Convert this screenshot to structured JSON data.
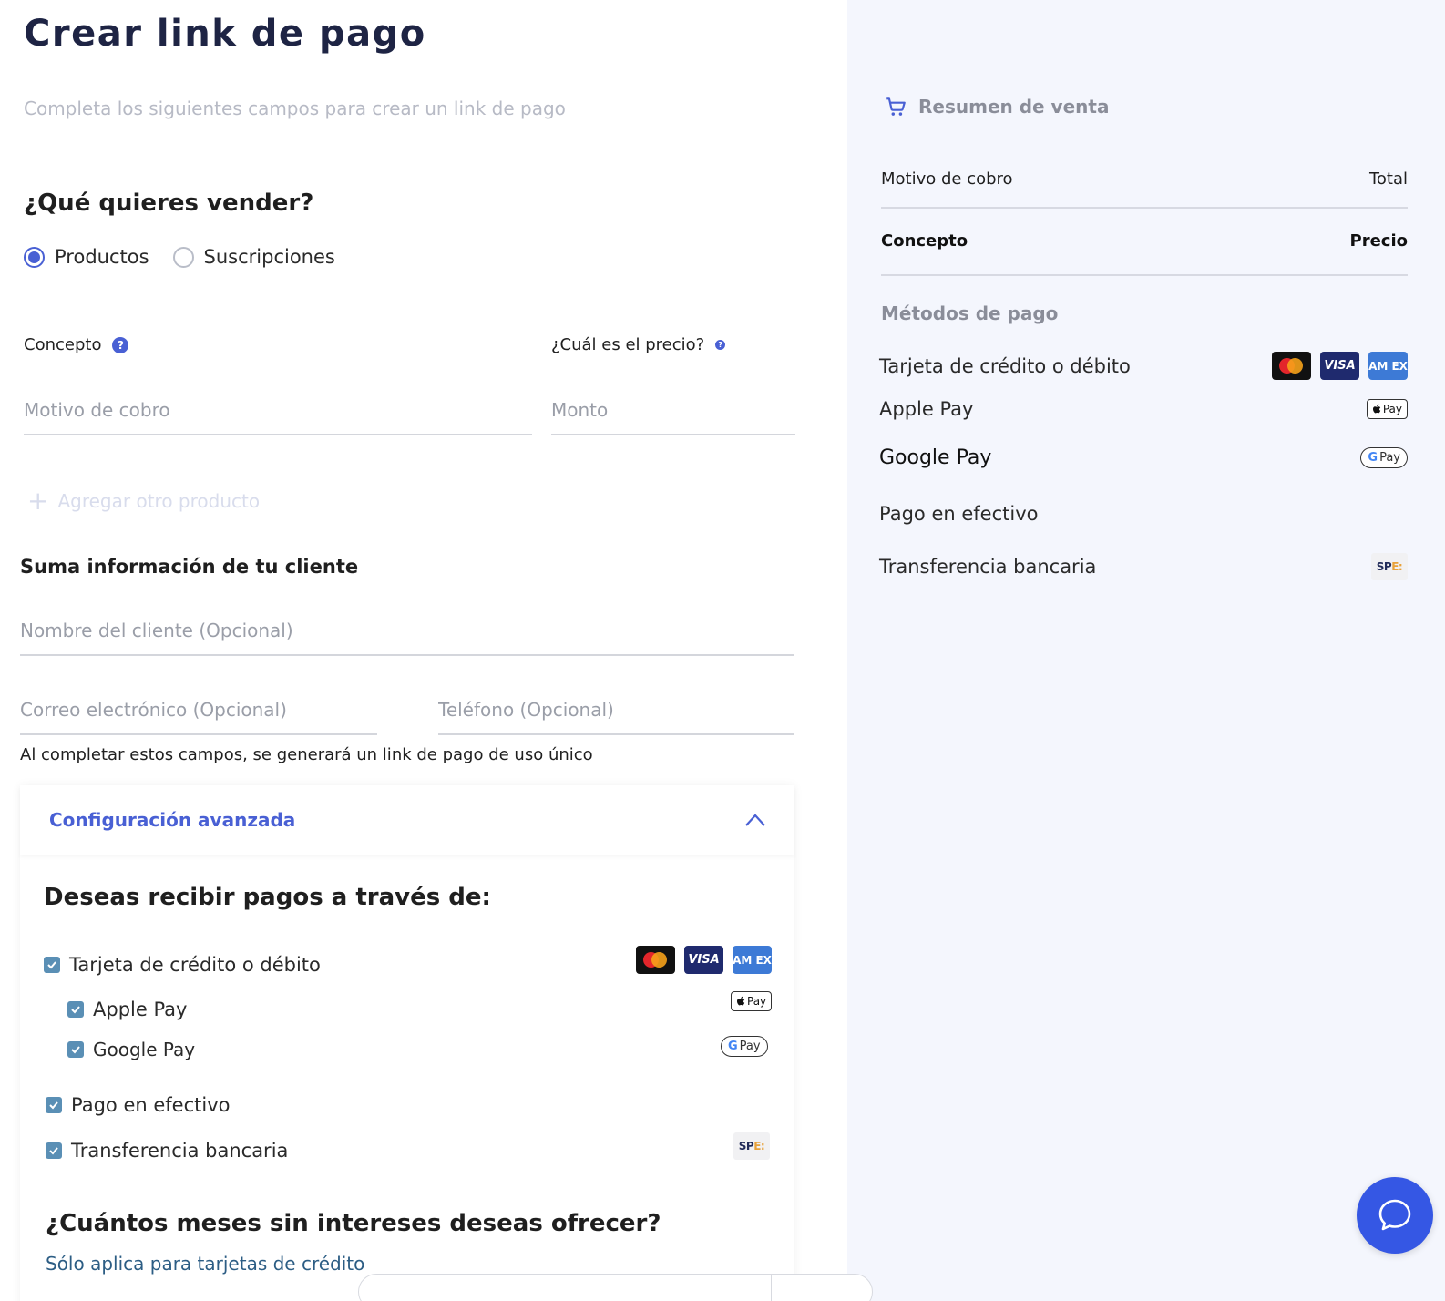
{
  "page": {
    "title": "Crear link de pago",
    "subtitle": "Completa los siguientes campos para crear un link de pago"
  },
  "sell": {
    "heading": "¿Qué quieres vender?",
    "options": [
      {
        "label": "Productos",
        "selected": true
      },
      {
        "label": "Suscripciones",
        "selected": false
      }
    ]
  },
  "product": {
    "concept_label": "Concepto",
    "concept_placeholder": "Motivo de cobro",
    "price_label": "¿Cuál es el precio?",
    "price_placeholder": "Monto",
    "add_label": "Agregar otro producto",
    "help_glyph": "?"
  },
  "client": {
    "heading": "Suma información de tu cliente",
    "name_placeholder": "Nombre del cliente (Opcional)",
    "email_placeholder": "Correo electrónico (Opcional)",
    "phone_placeholder": "Teléfono (Opcional)",
    "note": "Al completar estos campos, se generará un link de pago de uso único"
  },
  "advanced": {
    "title": "Configuración avanzada",
    "payments_heading": "Deseas recibir pagos a través de:",
    "methods": [
      {
        "label": "Tarjeta de crédito o débito",
        "checked": true
      },
      {
        "label": "Apple Pay",
        "checked": true
      },
      {
        "label": "Google Pay",
        "checked": true
      },
      {
        "label": "Pago en efectivo",
        "checked": true
      },
      {
        "label": "Transferencia bancaria",
        "checked": true
      }
    ],
    "msi_heading": "¿Cuántos meses sin intereses deseas ofrecer?",
    "msi_note": "Sólo aplica para tarjetas de crédito"
  },
  "logos": {
    "visa": "VISA",
    "amex": "AM EX",
    "apple_pay": "Pay",
    "google_pay_g": "G",
    "google_pay": "Pay",
    "spei_a": "SP",
    "spei_b": "E:"
  },
  "summary": {
    "title": "Resumen de venta",
    "col_left": "Motivo de cobro",
    "col_right": "Total",
    "row_left": "Concepto",
    "row_right": "Precio",
    "methods_title": "Métodos de pago",
    "methods": [
      "Tarjeta de crédito o débito",
      "Apple Pay",
      "Google Pay",
      "Pago en efectivo",
      "Transferencia bancaria"
    ]
  },
  "colors": {
    "primary": "#4960d4",
    "checkbox": "#5a8fb5",
    "panel_bg": "#f4f6fd",
    "chat_button": "#3557e4"
  }
}
